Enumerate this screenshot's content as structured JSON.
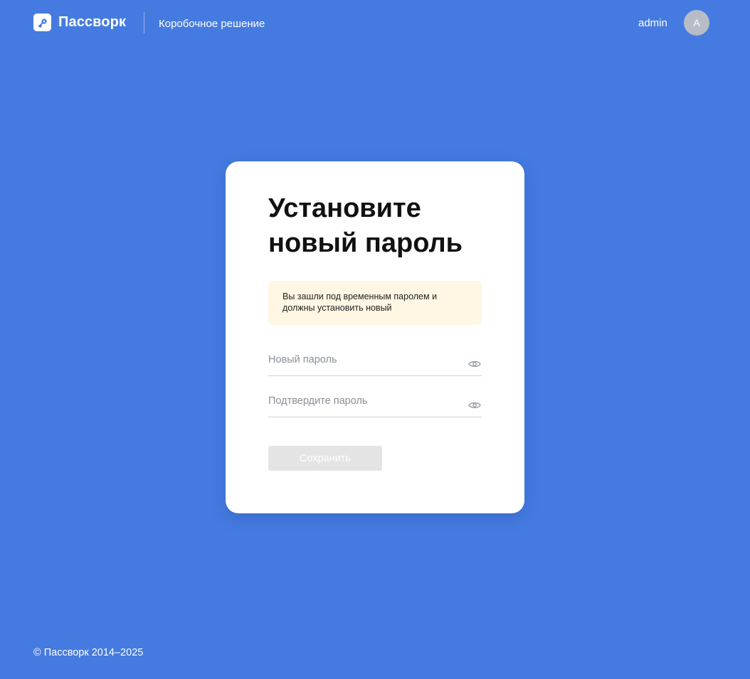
{
  "header": {
    "brand_name": "Пассворк",
    "product_name": "Коробочное решение",
    "user_name": "admin",
    "avatar_initial": "A"
  },
  "card": {
    "title": "Установите новый пароль",
    "notice": "Вы зашли под временным паролем и должны установить новый",
    "new_password": {
      "value": "",
      "placeholder": "Новый пароль"
    },
    "confirm_password": {
      "value": "",
      "placeholder": "Подтвердите пароль"
    },
    "save_label": "Сохранить"
  },
  "footer": {
    "copyright": "© Пассворк 2014–2025"
  },
  "icons": {
    "logo": "key-icon",
    "reveal": "eye-icon"
  },
  "colors": {
    "background": "#457be0",
    "card": "#ffffff",
    "notice_background": "#fff6e3",
    "button_disabled": "#e4e4e4",
    "avatar": "#b7bcc6"
  }
}
